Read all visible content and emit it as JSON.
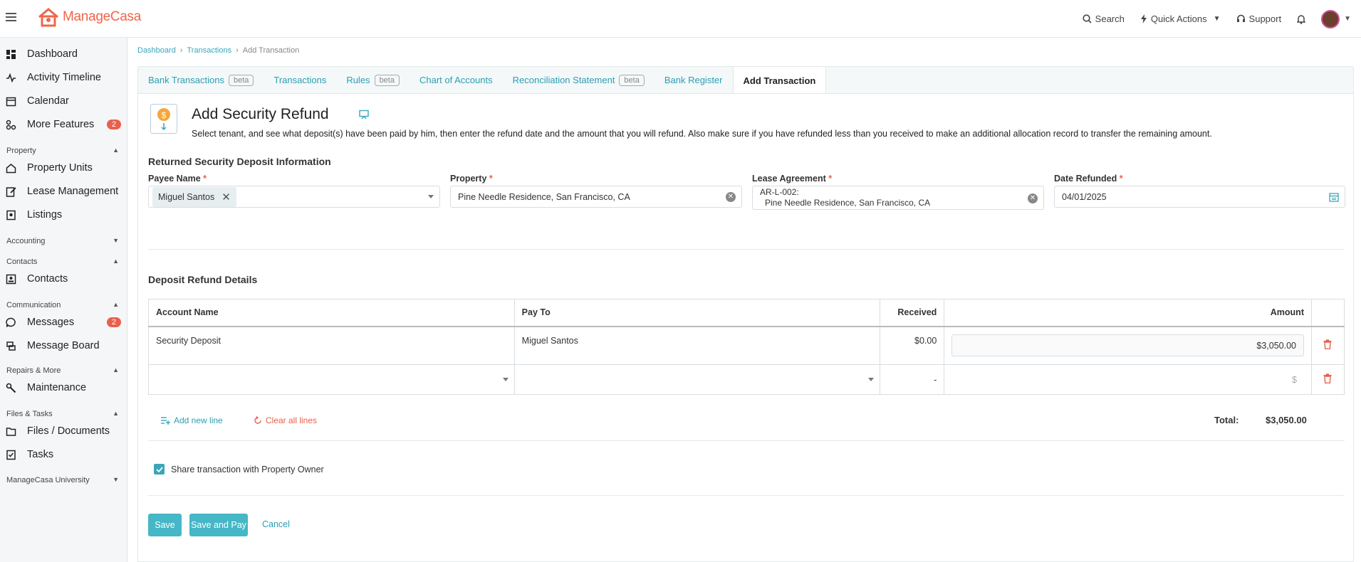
{
  "header": {
    "logo_text": "ManageCasa",
    "search_label": "Search",
    "quick_actions_label": "Quick Actions",
    "support_label": "Support"
  },
  "sidebar": {
    "dashboard": "Dashboard",
    "activity": "Activity Timeline",
    "calendar": "Calendar",
    "more_features": "More Features",
    "more_features_badge": "2",
    "sec_property": "Property",
    "property_units": "Property Units",
    "lease_management": "Lease Management",
    "listings": "Listings",
    "sec_accounting": "Accounting",
    "sec_contacts": "Contacts",
    "contacts": "Contacts",
    "sec_communication": "Communication",
    "messages": "Messages",
    "messages_badge": "2",
    "message_board": "Message Board",
    "sec_repairs": "Repairs & More",
    "maintenance": "Maintenance",
    "sec_files": "Files & Tasks",
    "files": "Files / Documents",
    "tasks": "Tasks",
    "sec_university": "ManageCasa University"
  },
  "breadcrumb": [
    "Dashboard",
    "Transactions",
    "Add Transaction"
  ],
  "tabs": {
    "bank_transactions": "Bank Transactions",
    "transactions": "Transactions",
    "rules": "Rules",
    "chart_of_accounts": "Chart of Accounts",
    "reconciliation": "Reconciliation Statement",
    "bank_register": "Bank Register",
    "add_transaction": "Add Transaction",
    "beta": "beta"
  },
  "page": {
    "title": "Add Security Refund",
    "description": "Select tenant, and see what deposit(s) have been paid by him, then enter the refund date and the amount that you will refund. Also make sure if you have refunded less than you received to make an additional allocation record to transfer the remaining amount."
  },
  "form": {
    "section1_title": "Returned Security Deposit Information",
    "payee_label": "Payee Name",
    "payee_value": "Miguel Santos",
    "property_label": "Property",
    "property_value": "Pine Needle Residence, San Francisco, CA",
    "lease_label": "Lease Agreement",
    "lease_value_line1": "AR-L-002:",
    "lease_value_line2": "Pine Needle Residence, San Francisco, CA",
    "date_label": "Date Refunded",
    "date_value": "04/01/2025",
    "required_mark": "*"
  },
  "refund": {
    "section_title": "Deposit Refund Details",
    "columns": {
      "account": "Account Name",
      "pay_to": "Pay To",
      "received": "Received",
      "amount": "Amount"
    },
    "row1": {
      "account": "Security Deposit",
      "pay_to": "Miguel Santos",
      "received": "$0.00",
      "amount": "$3,050.00"
    },
    "row2": {
      "received": "-",
      "amount_placeholder": "$"
    },
    "add_line": "Add new line",
    "clear_lines": "Clear all lines",
    "total_label": "Total:",
    "total_value": "$3,050.00"
  },
  "share": {
    "label": "Share transaction with Property Owner",
    "checked": true
  },
  "buttons": {
    "save": "Save",
    "save_and_pay": "Save and Pay",
    "cancel": "Cancel"
  },
  "colors": {
    "accent": "#45b7c6",
    "brand": "#f0654a",
    "badge": "#e8604c"
  }
}
